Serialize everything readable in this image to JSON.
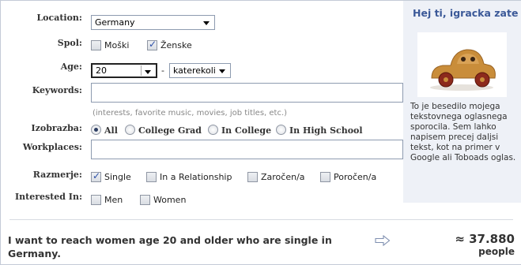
{
  "form": {
    "location": {
      "label": "Location:",
      "value": "Germany"
    },
    "gender": {
      "label": "Spol:",
      "options": [
        {
          "label": "Moški",
          "checked": false
        },
        {
          "label": "Ženske",
          "checked": true
        }
      ]
    },
    "age": {
      "label": "Age:",
      "from": "20",
      "separator": "-",
      "to": "katerekoli"
    },
    "keywords": {
      "label": "Keywords:",
      "value": "",
      "hint": "(interests, favorite music, movies, job titles, etc.)"
    },
    "education": {
      "label": "Izobrazba:",
      "options": [
        {
          "label": "All",
          "selected": true
        },
        {
          "label": "College Grad",
          "selected": false
        },
        {
          "label": "In College",
          "selected": false
        },
        {
          "label": "In High School",
          "selected": false
        }
      ]
    },
    "workplaces": {
      "label": "Workplaces:",
      "value": ""
    },
    "relationship": {
      "label": "Razmerje:",
      "options": [
        {
          "label": "Single",
          "checked": true
        },
        {
          "label": "In a Relationship",
          "checked": false
        },
        {
          "label": "Zaročen/a",
          "checked": false
        },
        {
          "label": "Poročen/a",
          "checked": false
        }
      ]
    },
    "interested_in": {
      "label": "Interested In:",
      "options": [
        {
          "label": "Men",
          "checked": false
        },
        {
          "label": "Women",
          "checked": false
        }
      ]
    }
  },
  "summary": {
    "text": "I want to reach women age 20 and older who are single in Germany.",
    "count": "≈ 37.880",
    "unit": "people"
  },
  "ad_preview": {
    "title": "Hej ti, igracka zate",
    "image": "wooden-toy-car",
    "body": "To je besedilo mojega tekstovnega oglasnega sporocila. Sem lahko napisem precej daljsi tekst, kot na primer v Google ali Toboads oglas."
  },
  "colors": {
    "accent": "#3b5998",
    "ad_background": "#eef1f7",
    "border": "#8e9bb0"
  }
}
